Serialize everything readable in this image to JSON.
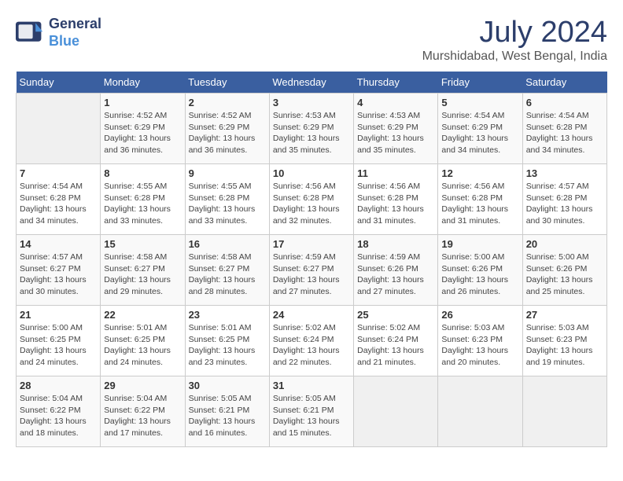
{
  "logo": {
    "line1": "General",
    "line2": "Blue"
  },
  "title": "July 2024",
  "location": "Murshidabad, West Bengal, India",
  "headers": [
    "Sunday",
    "Monday",
    "Tuesday",
    "Wednesday",
    "Thursday",
    "Friday",
    "Saturday"
  ],
  "weeks": [
    [
      {
        "day": "",
        "info": ""
      },
      {
        "day": "1",
        "info": "Sunrise: 4:52 AM\nSunset: 6:29 PM\nDaylight: 13 hours\nand 36 minutes."
      },
      {
        "day": "2",
        "info": "Sunrise: 4:52 AM\nSunset: 6:29 PM\nDaylight: 13 hours\nand 36 minutes."
      },
      {
        "day": "3",
        "info": "Sunrise: 4:53 AM\nSunset: 6:29 PM\nDaylight: 13 hours\nand 35 minutes."
      },
      {
        "day": "4",
        "info": "Sunrise: 4:53 AM\nSunset: 6:29 PM\nDaylight: 13 hours\nand 35 minutes."
      },
      {
        "day": "5",
        "info": "Sunrise: 4:54 AM\nSunset: 6:29 PM\nDaylight: 13 hours\nand 34 minutes."
      },
      {
        "day": "6",
        "info": "Sunrise: 4:54 AM\nSunset: 6:28 PM\nDaylight: 13 hours\nand 34 minutes."
      }
    ],
    [
      {
        "day": "7",
        "info": "Sunrise: 4:54 AM\nSunset: 6:28 PM\nDaylight: 13 hours\nand 34 minutes."
      },
      {
        "day": "8",
        "info": "Sunrise: 4:55 AM\nSunset: 6:28 PM\nDaylight: 13 hours\nand 33 minutes."
      },
      {
        "day": "9",
        "info": "Sunrise: 4:55 AM\nSunset: 6:28 PM\nDaylight: 13 hours\nand 33 minutes."
      },
      {
        "day": "10",
        "info": "Sunrise: 4:56 AM\nSunset: 6:28 PM\nDaylight: 13 hours\nand 32 minutes."
      },
      {
        "day": "11",
        "info": "Sunrise: 4:56 AM\nSunset: 6:28 PM\nDaylight: 13 hours\nand 31 minutes."
      },
      {
        "day": "12",
        "info": "Sunrise: 4:56 AM\nSunset: 6:28 PM\nDaylight: 13 hours\nand 31 minutes."
      },
      {
        "day": "13",
        "info": "Sunrise: 4:57 AM\nSunset: 6:28 PM\nDaylight: 13 hours\nand 30 minutes."
      }
    ],
    [
      {
        "day": "14",
        "info": "Sunrise: 4:57 AM\nSunset: 6:27 PM\nDaylight: 13 hours\nand 30 minutes."
      },
      {
        "day": "15",
        "info": "Sunrise: 4:58 AM\nSunset: 6:27 PM\nDaylight: 13 hours\nand 29 minutes."
      },
      {
        "day": "16",
        "info": "Sunrise: 4:58 AM\nSunset: 6:27 PM\nDaylight: 13 hours\nand 28 minutes."
      },
      {
        "day": "17",
        "info": "Sunrise: 4:59 AM\nSunset: 6:27 PM\nDaylight: 13 hours\nand 27 minutes."
      },
      {
        "day": "18",
        "info": "Sunrise: 4:59 AM\nSunset: 6:26 PM\nDaylight: 13 hours\nand 27 minutes."
      },
      {
        "day": "19",
        "info": "Sunrise: 5:00 AM\nSunset: 6:26 PM\nDaylight: 13 hours\nand 26 minutes."
      },
      {
        "day": "20",
        "info": "Sunrise: 5:00 AM\nSunset: 6:26 PM\nDaylight: 13 hours\nand 25 minutes."
      }
    ],
    [
      {
        "day": "21",
        "info": "Sunrise: 5:00 AM\nSunset: 6:25 PM\nDaylight: 13 hours\nand 24 minutes."
      },
      {
        "day": "22",
        "info": "Sunrise: 5:01 AM\nSunset: 6:25 PM\nDaylight: 13 hours\nand 24 minutes."
      },
      {
        "day": "23",
        "info": "Sunrise: 5:01 AM\nSunset: 6:25 PM\nDaylight: 13 hours\nand 23 minutes."
      },
      {
        "day": "24",
        "info": "Sunrise: 5:02 AM\nSunset: 6:24 PM\nDaylight: 13 hours\nand 22 minutes."
      },
      {
        "day": "25",
        "info": "Sunrise: 5:02 AM\nSunset: 6:24 PM\nDaylight: 13 hours\nand 21 minutes."
      },
      {
        "day": "26",
        "info": "Sunrise: 5:03 AM\nSunset: 6:23 PM\nDaylight: 13 hours\nand 20 minutes."
      },
      {
        "day": "27",
        "info": "Sunrise: 5:03 AM\nSunset: 6:23 PM\nDaylight: 13 hours\nand 19 minutes."
      }
    ],
    [
      {
        "day": "28",
        "info": "Sunrise: 5:04 AM\nSunset: 6:22 PM\nDaylight: 13 hours\nand 18 minutes."
      },
      {
        "day": "29",
        "info": "Sunrise: 5:04 AM\nSunset: 6:22 PM\nDaylight: 13 hours\nand 17 minutes."
      },
      {
        "day": "30",
        "info": "Sunrise: 5:05 AM\nSunset: 6:21 PM\nDaylight: 13 hours\nand 16 minutes."
      },
      {
        "day": "31",
        "info": "Sunrise: 5:05 AM\nSunset: 6:21 PM\nDaylight: 13 hours\nand 15 minutes."
      },
      {
        "day": "",
        "info": ""
      },
      {
        "day": "",
        "info": ""
      },
      {
        "day": "",
        "info": ""
      }
    ]
  ]
}
